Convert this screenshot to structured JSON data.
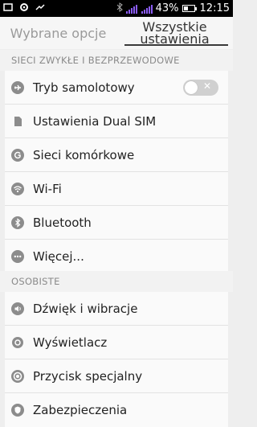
{
  "status_bar": {
    "battery": "43%",
    "battery_level": 0.43,
    "time": "12:15",
    "icons": [
      "screen-icon",
      "settings-cog-icon",
      "link-icon",
      "bluetooth-icon",
      "signal-icon"
    ]
  },
  "tabs": [
    {
      "label": "Wybrane opcje",
      "active": false
    },
    {
      "label": "Wszystkie ustawienia",
      "active": true
    }
  ],
  "sections": {
    "wireless": {
      "header": "SIECI ZWYKŁE I BEZPRZEWODOWE",
      "items": [
        {
          "label": "Tryb samolotowy",
          "icon": "airplane-icon",
          "toggle": false,
          "toggle_mark": "✕"
        },
        {
          "label": "Ustawienia Dual SIM",
          "icon": "sim-icon"
        },
        {
          "label": "Sieci komórkowe",
          "icon": "mobile-network-icon"
        },
        {
          "label": "Wi-Fi",
          "icon": "wifi-icon"
        },
        {
          "label": "Bluetooth",
          "icon": "bluetooth-icon"
        },
        {
          "label": "Więcej...",
          "icon": "more-icon"
        }
      ]
    },
    "personal": {
      "header": "OSOBISTE",
      "items": [
        {
          "label": "Dźwięk i wibracje",
          "icon": "sound-icon"
        },
        {
          "label": "Wyświetlacz",
          "icon": "display-icon"
        },
        {
          "label": "Przycisk specjalny",
          "icon": "special-button-icon"
        },
        {
          "label": "Zabezpieczenia",
          "icon": "security-icon"
        }
      ]
    }
  },
  "colors": {
    "icon": "#8c8c8c",
    "bg": "#eeeeee",
    "row": "#fafafa"
  }
}
